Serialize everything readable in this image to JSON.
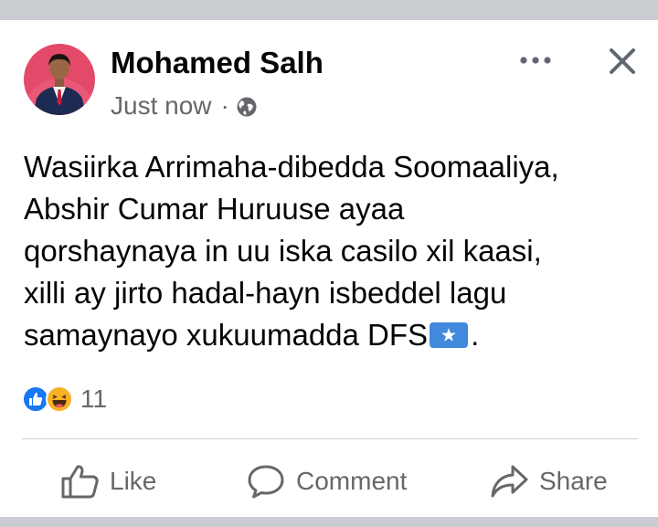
{
  "post": {
    "author": "Mohamed Salh",
    "timestamp": "Just now",
    "separator": "·",
    "privacy_icon": "globe-icon",
    "lines": [
      "Wasiirka Arrimaha-dibedda Soomaaliya,",
      "Abshir Cumar Huruuse ayaa",
      "qorshaynaya in uu iska casilo xil kaasi,",
      "xilli ay jirto hadal-hayn isbeddel lagu",
      "samaynayo xukuumadda DFS"
    ],
    "line_end": "."
  },
  "reactions": {
    "icons": [
      "like-reaction-icon",
      "haha-reaction-icon"
    ],
    "count": "11"
  },
  "actions": {
    "like": "Like",
    "comment": "Comment",
    "share": "Share"
  },
  "colors": {
    "page_background": "#c9ccd1",
    "card_background": "#ffffff",
    "text_primary": "#050505",
    "text_secondary": "#65676b",
    "like_blue": "#1877f2",
    "divider": "#ced0d4"
  }
}
